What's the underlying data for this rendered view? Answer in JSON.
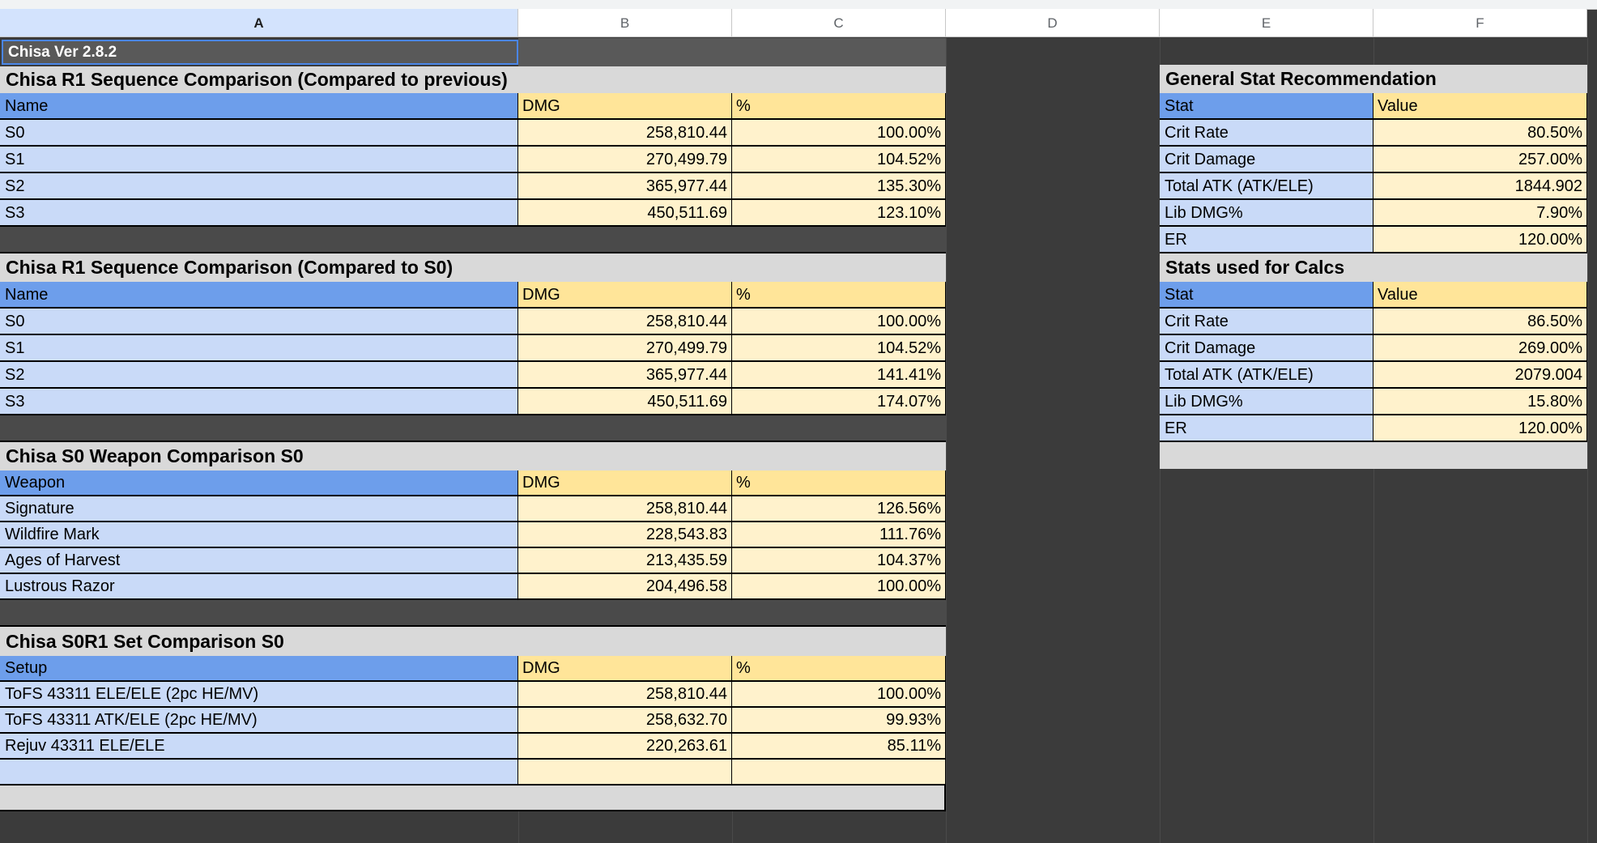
{
  "columns": [
    "A",
    "B",
    "C",
    "D",
    "E",
    "F"
  ],
  "version_label": "Chisa Ver 2.8.2",
  "tables": {
    "seq_prev": {
      "title": "Chisa R1 Sequence Comparison (Compared to previous)",
      "headers": [
        "Name",
        "DMG",
        "%"
      ],
      "rows": [
        [
          "S0",
          "258,810.44",
          "100.00%"
        ],
        [
          "S1",
          "270,499.79",
          "104.52%"
        ],
        [
          "S2",
          "365,977.44",
          "135.30%"
        ],
        [
          "S3",
          "450,511.69",
          "123.10%"
        ]
      ]
    },
    "seq_s0": {
      "title": "Chisa R1 Sequence Comparison (Compared to S0)",
      "headers": [
        "Name",
        "DMG",
        "%"
      ],
      "rows": [
        [
          "S0",
          "258,810.44",
          "100.00%"
        ],
        [
          "S1",
          "270,499.79",
          "104.52%"
        ],
        [
          "S2",
          "365,977.44",
          "141.41%"
        ],
        [
          "S3",
          "450,511.69",
          "174.07%"
        ]
      ]
    },
    "weapon": {
      "title": "Chisa S0 Weapon Comparison S0",
      "headers": [
        "Weapon",
        "DMG",
        "%"
      ],
      "rows": [
        [
          "Signature",
          "258,810.44",
          "126.56%"
        ],
        [
          "Wildfire Mark",
          "228,543.83",
          "111.76%"
        ],
        [
          "Ages of Harvest",
          "213,435.59",
          "104.37%"
        ],
        [
          "Lustrous Razor",
          "204,496.58",
          "100.00%"
        ]
      ]
    },
    "set": {
      "title": "Chisa S0R1 Set Comparison S0",
      "headers": [
        "Setup",
        "DMG",
        "%"
      ],
      "rows": [
        [
          "ToFS 43311 ELE/ELE (2pc HE/MV)",
          "258,810.44",
          "100.00%"
        ],
        [
          "ToFS 43311 ATK/ELE (2pc HE/MV)",
          "258,632.70",
          "99.93%"
        ],
        [
          "Rejuv 43311 ELE/ELE",
          "220,263.61",
          "85.11%"
        ],
        [
          "",
          "",
          ""
        ]
      ]
    },
    "general": {
      "title": "General Stat Recommendation",
      "headers": [
        "Stat",
        "Value"
      ],
      "rows": [
        [
          "Crit Rate",
          "80.50%"
        ],
        [
          "Crit Damage",
          "257.00%"
        ],
        [
          "Total ATK (ATK/ELE)",
          "1844.902"
        ],
        [
          "Lib DMG%",
          "7.90%"
        ],
        [
          "ER",
          "120.00%"
        ]
      ]
    },
    "calcs": {
      "title": "Stats used for Calcs",
      "headers": [
        "Stat",
        "Value"
      ],
      "rows": [
        [
          "Crit Rate",
          "86.50%"
        ],
        [
          "Crit Damage",
          "269.00%"
        ],
        [
          "Total ATK (ATK/ELE)",
          "2079.004"
        ],
        [
          "Lib DMG%",
          "15.80%"
        ],
        [
          "ER",
          "120.00%"
        ]
      ]
    }
  },
  "colors": {
    "name_cell": "#c9daf8",
    "header_name": "#6d9eeb",
    "dmg_cell": "#fff2cc",
    "header_dmg": "#ffe599",
    "title_band": "#d9d9d9",
    "background": "#3b3b3b",
    "version_cell": "#595959"
  }
}
